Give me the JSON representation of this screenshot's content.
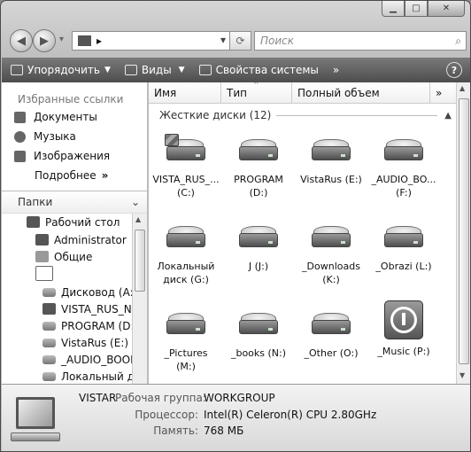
{
  "window": {
    "minimize": "▁",
    "maximize": "□",
    "close": "✕"
  },
  "nav": {
    "back": "◀",
    "forward": "▶",
    "address_arrow": "▸",
    "dropdown": "▾",
    "search_placeholder": "Поиск"
  },
  "toolbar": {
    "organize": "Упорядочить",
    "views": "Виды",
    "system_props": "Свойства системы",
    "more": "»",
    "help": "?"
  },
  "sidebar": {
    "favorites_title": "Избранные ссылки",
    "favorites": [
      "Документы",
      "Музыка",
      "Изображения"
    ],
    "more": "Подробнее",
    "more_arrows": "»",
    "folders": "Папки",
    "tree": [
      "Рабочий стол",
      "Administrator",
      "Общие",
      "",
      "Дисковод (A:)",
      "VISTA_RUS_NE",
      "PROGRAM (D:)",
      "VistaRus (E:)",
      "_AUDIO_BOOK",
      "Локальный ди"
    ]
  },
  "columns": [
    "Имя",
    "Тип",
    "Полный объем",
    "»"
  ],
  "group": {
    "title": "Жесткие диски (12)"
  },
  "drives": [
    {
      "l1": "VISTA_RUS_...",
      "l2": "(C:)"
    },
    {
      "l1": "PROGRAM",
      "l2": "(D:)"
    },
    {
      "l1": "VistaRus (E:)",
      "l2": ""
    },
    {
      "l1": "_AUDIO_BO...",
      "l2": "(F:)"
    },
    {
      "l1": "Локальный",
      "l2": "диск (G:)"
    },
    {
      "l1": "J (J:)",
      "l2": ""
    },
    {
      "l1": "_Downloads",
      "l2": "(K:)"
    },
    {
      "l1": "_Obrazi (L:)",
      "l2": ""
    },
    {
      "l1": "_Pictures",
      "l2": "(M:)"
    },
    {
      "l1": "_books (N:)",
      "l2": ""
    },
    {
      "l1": "_Other (O:)",
      "l2": ""
    },
    {
      "l1": "_Music (P:)",
      "l2": ""
    }
  ],
  "details": {
    "name": "VISTAR",
    "workgroup_label": "Рабочая группа:",
    "workgroup": "WORKGROUP",
    "cpu_label": "Процессор:",
    "cpu": "Intel(R) Celeron(R) CPU 2.80GHz",
    "mem_label": "Память:",
    "mem": "768 МБ"
  }
}
